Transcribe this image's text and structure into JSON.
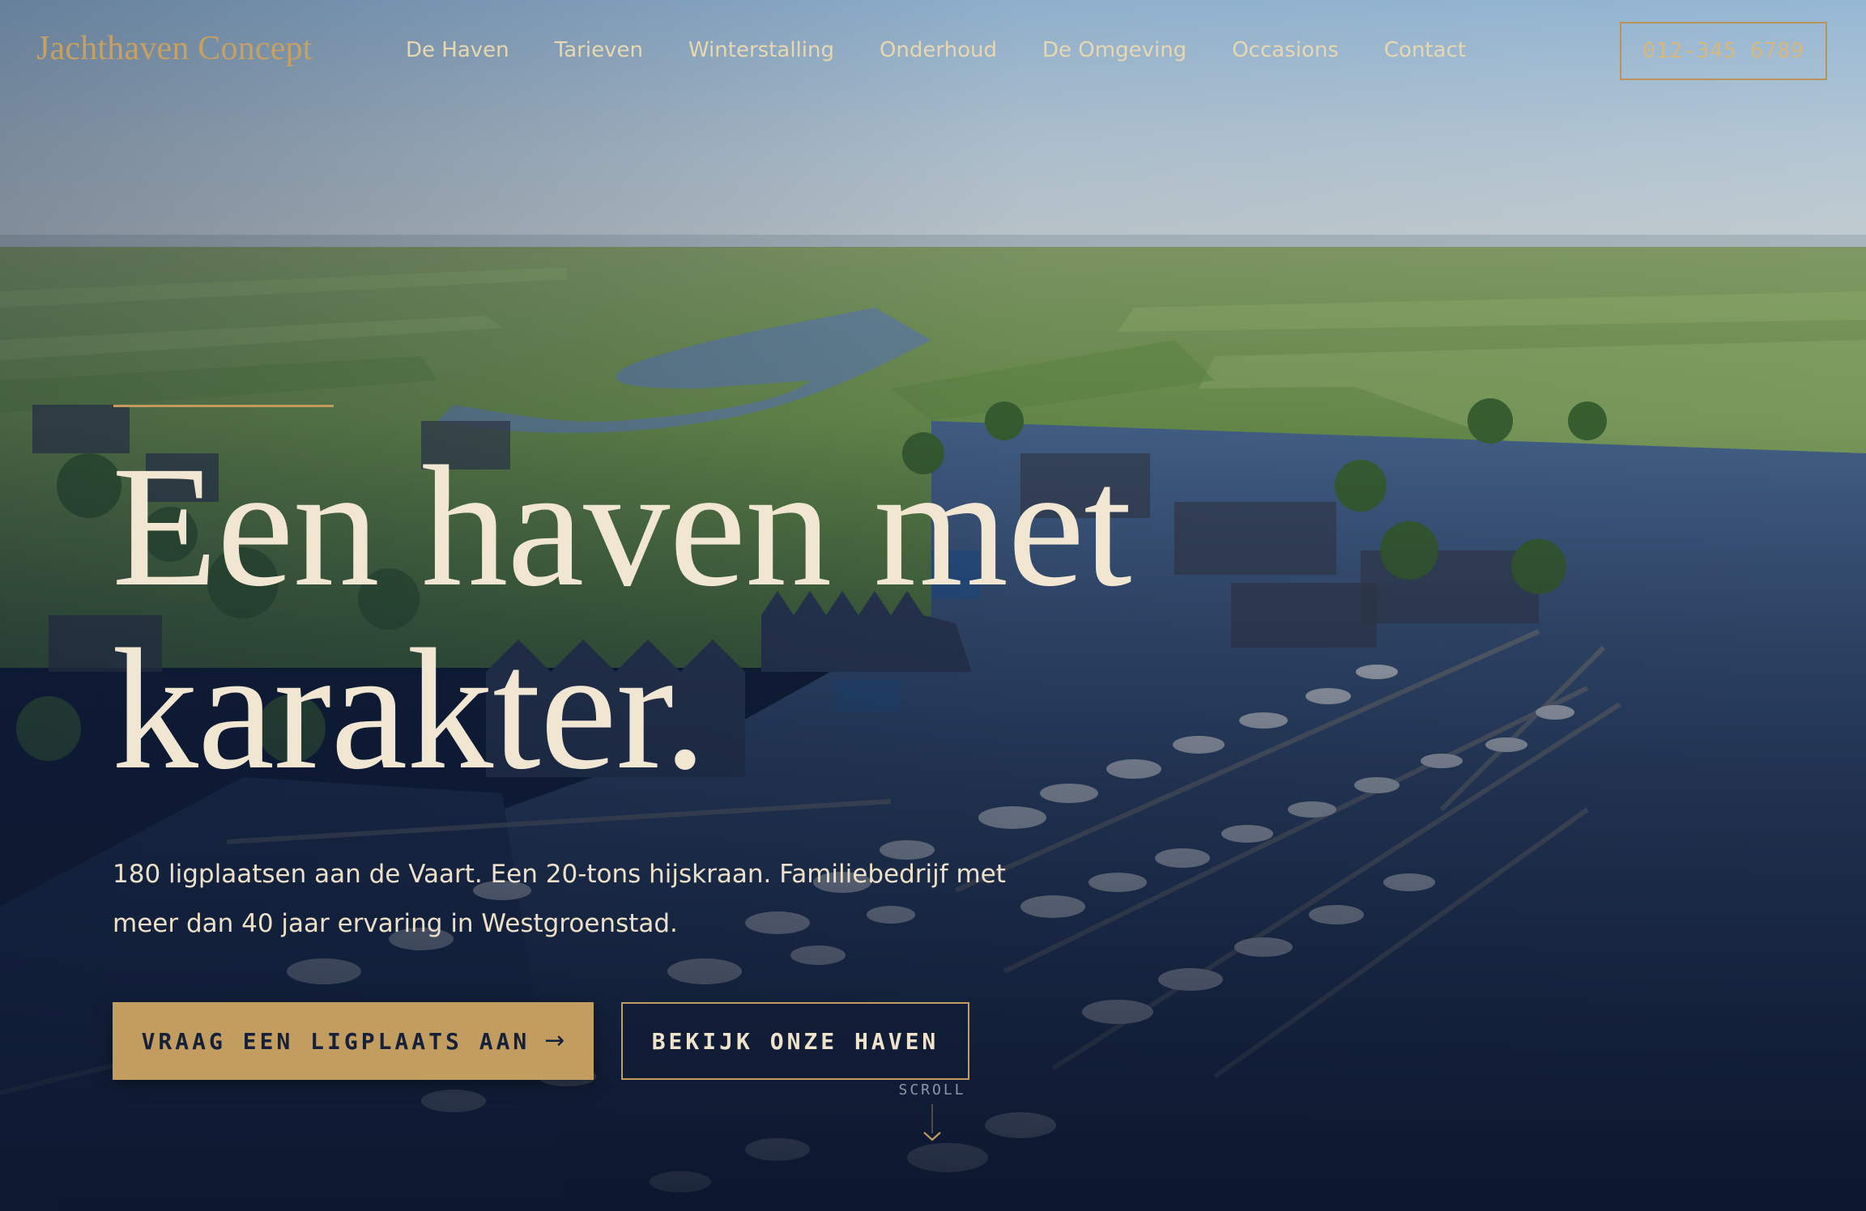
{
  "header": {
    "logo": "Jachthaven Concept",
    "nav": [
      {
        "label": "De Haven"
      },
      {
        "label": "Tarieven"
      },
      {
        "label": "Winterstalling"
      },
      {
        "label": "Onderhoud"
      },
      {
        "label": "De Omgeving"
      },
      {
        "label": "Occasions"
      },
      {
        "label": "Contact"
      }
    ],
    "phone": "012-345 6789"
  },
  "hero": {
    "title_line1": "Een haven met",
    "title_line2": "karakter.",
    "subtitle": "180 ligplaatsen aan de Vaart. Een 20-tons hijskraan. Familiebedrijf met meer dan 40 jaar ervaring in Westgroenstad.",
    "primary_cta": "VRAAG EEN LIGPLAATS AAN",
    "primary_cta_icon": "arrow-right-icon",
    "secondary_cta": "BEKIJK ONZE HAVEN",
    "scroll_label": "SCROLL",
    "scroll_icon": "chevron-down-icon",
    "background_image": "aerial view of marina with boats, houses and green polder landscape"
  },
  "colors": {
    "accent_gold": "#c39c60",
    "navy": "#15213a",
    "cream_text": "#f1e6d2"
  }
}
